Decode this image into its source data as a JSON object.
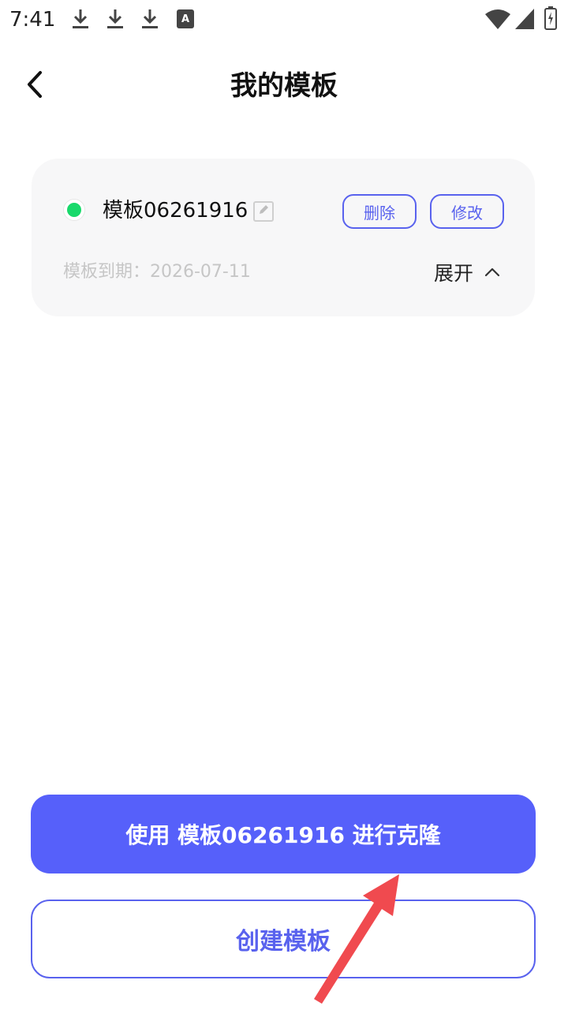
{
  "status_bar": {
    "time": "7:41",
    "icons": [
      "download-icon",
      "download-icon",
      "download-icon",
      "accessibility-a-icon",
      "wifi-icon",
      "signal-icon",
      "battery-charging-icon"
    ]
  },
  "header": {
    "title": "我的模板",
    "back_icon": "chevron-left-icon"
  },
  "template_card": {
    "status_color": "#19d96b",
    "name": "模板06261916",
    "delete_label": "删除",
    "modify_label": "修改",
    "expiry": "模板到期：2026-07-11",
    "expand_label": "展开"
  },
  "actions": {
    "clone_label": "使用 模板06261916 进行克隆",
    "create_label": "创建模板"
  },
  "colors": {
    "accent": "#5660fa",
    "annotation_arrow": "#f04a4f"
  }
}
